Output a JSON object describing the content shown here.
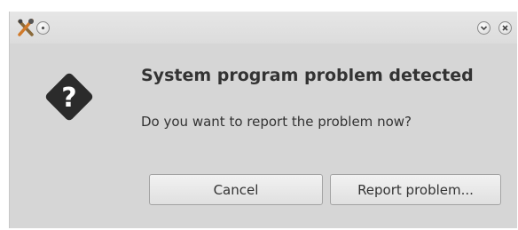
{
  "dialog": {
    "title": "System program problem detected",
    "message": "Do you want to report the problem now?"
  },
  "buttons": {
    "cancel_label": "Cancel",
    "report_label": "Report problem..."
  },
  "titlebar": {
    "app_icon": "tools-icon",
    "sticky_icon": "dot-icon",
    "minimize_icon": "chevron-down-icon",
    "close_icon": "close-icon"
  },
  "colors": {
    "window_bg": "#d6d6d6",
    "text": "#333333",
    "question_icon": "#2b2b2b"
  }
}
